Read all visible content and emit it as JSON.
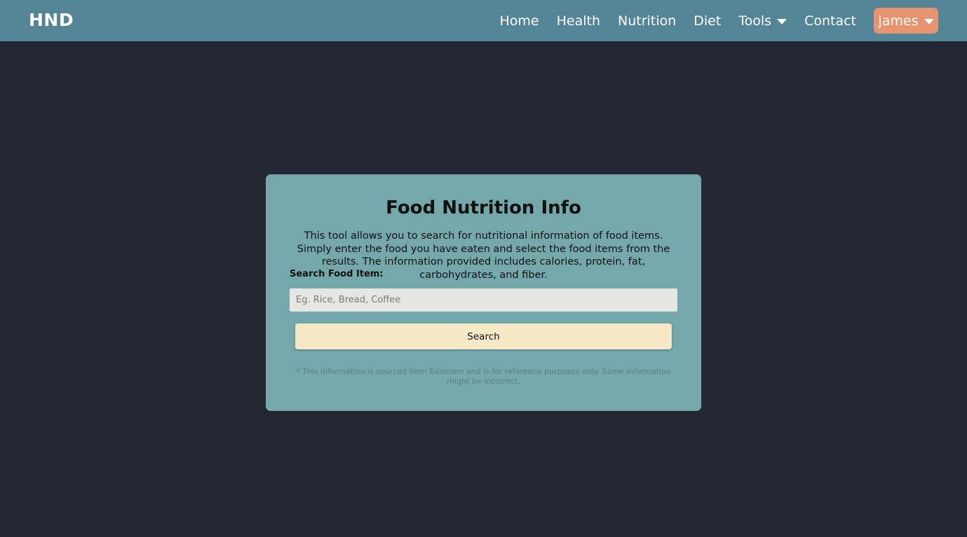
{
  "nav": {
    "brand": "HND",
    "links": [
      {
        "label": "Home"
      },
      {
        "label": "Health"
      },
      {
        "label": "Nutrition"
      },
      {
        "label": "Diet"
      },
      {
        "label": "Tools",
        "has_dropdown": true
      },
      {
        "label": "Contact"
      }
    ],
    "user": {
      "label": "james",
      "has_dropdown": true
    }
  },
  "card": {
    "title": "Food Nutrition Info",
    "description": "This tool allows you to search for nutritional information of food items. Simply enter the food you have eaten and select the food items from the results. The information provided includes calories, protein, fat, carbohydrates, and fiber.",
    "search_label": "Search Food Item:",
    "search_placeholder": "Eg. Rice, Bread, Coffee",
    "search_value": "",
    "search_button": "Search",
    "disclaimer": "* This information is sourced from Edamam and is for reference purposes only. Some information might be incorrect."
  },
  "colors": {
    "navbar": "#548596",
    "background": "#222731",
    "card": "#74a8ab",
    "user_button": "#e6946f",
    "search_button": "#f5e8c6"
  },
  "icons": {
    "tools_dropdown": "chevron-down-icon",
    "user_dropdown": "chevron-down-icon"
  }
}
